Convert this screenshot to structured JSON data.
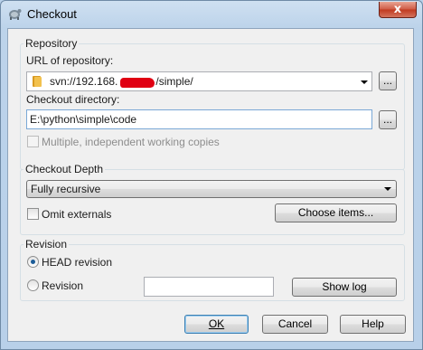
{
  "window": {
    "title": "Checkout",
    "close_symbol": "x"
  },
  "repository": {
    "legend": "Repository",
    "url_label": "URL of repository:",
    "url_value": "svn://192.168.",
    "url_value_tail": "/simple/",
    "browse_label": "...",
    "dir_label": "Checkout directory:",
    "dir_value": "E:\\python\\simple\\code",
    "dir_browse_label": "...",
    "multiple_label": "Multiple, independent working copies"
  },
  "depth": {
    "legend": "Checkout Depth",
    "selected": "Fully recursive",
    "omit_label": "Omit externals",
    "choose_label": "Choose items..."
  },
  "revision": {
    "legend": "Revision",
    "head_label": "HEAD revision",
    "revision_label": "Revision",
    "revision_value": "",
    "showlog_label": "Show log"
  },
  "buttons": {
    "ok": "OK",
    "cancel": "Cancel",
    "help": "Help"
  },
  "colors": {
    "titlebar": "#bcd3ea",
    "dialog_bg": "#f0f0f0",
    "close": "#c0391f",
    "redaction": "#e00012"
  }
}
